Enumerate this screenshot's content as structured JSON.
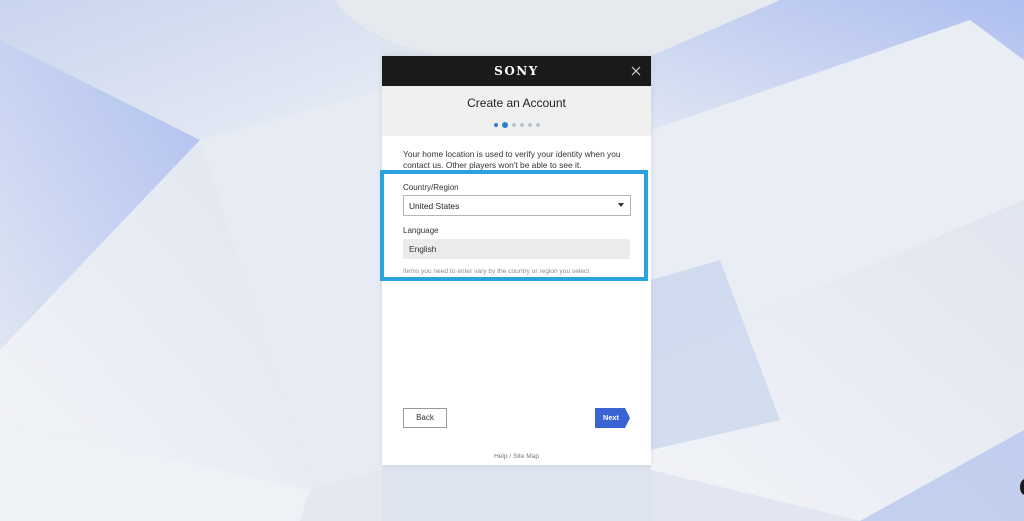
{
  "brand": {
    "logo_text": "SONY",
    "close_icon": "close-icon"
  },
  "header": {
    "title": "Create an Account",
    "steps_total": 6,
    "steps_done": 1,
    "current_step": 2
  },
  "content": {
    "intro": "Your home location is used to verify your identity when you contact us. Other players won't be able to see it.",
    "country_label": "Country/Region",
    "country_value": "United States",
    "language_label": "Language",
    "language_value": "English",
    "hint": "Items you need to enter vary by the country or region you select"
  },
  "actions": {
    "back_label": "Back",
    "next_label": "Next"
  },
  "footer": {
    "link_text": "Help / Site Map"
  },
  "colors": {
    "highlight": "#2aa3dc",
    "next_button": "#3a63d3",
    "step_active": "#2d7fd3",
    "topbar": "#1a1a1a"
  }
}
